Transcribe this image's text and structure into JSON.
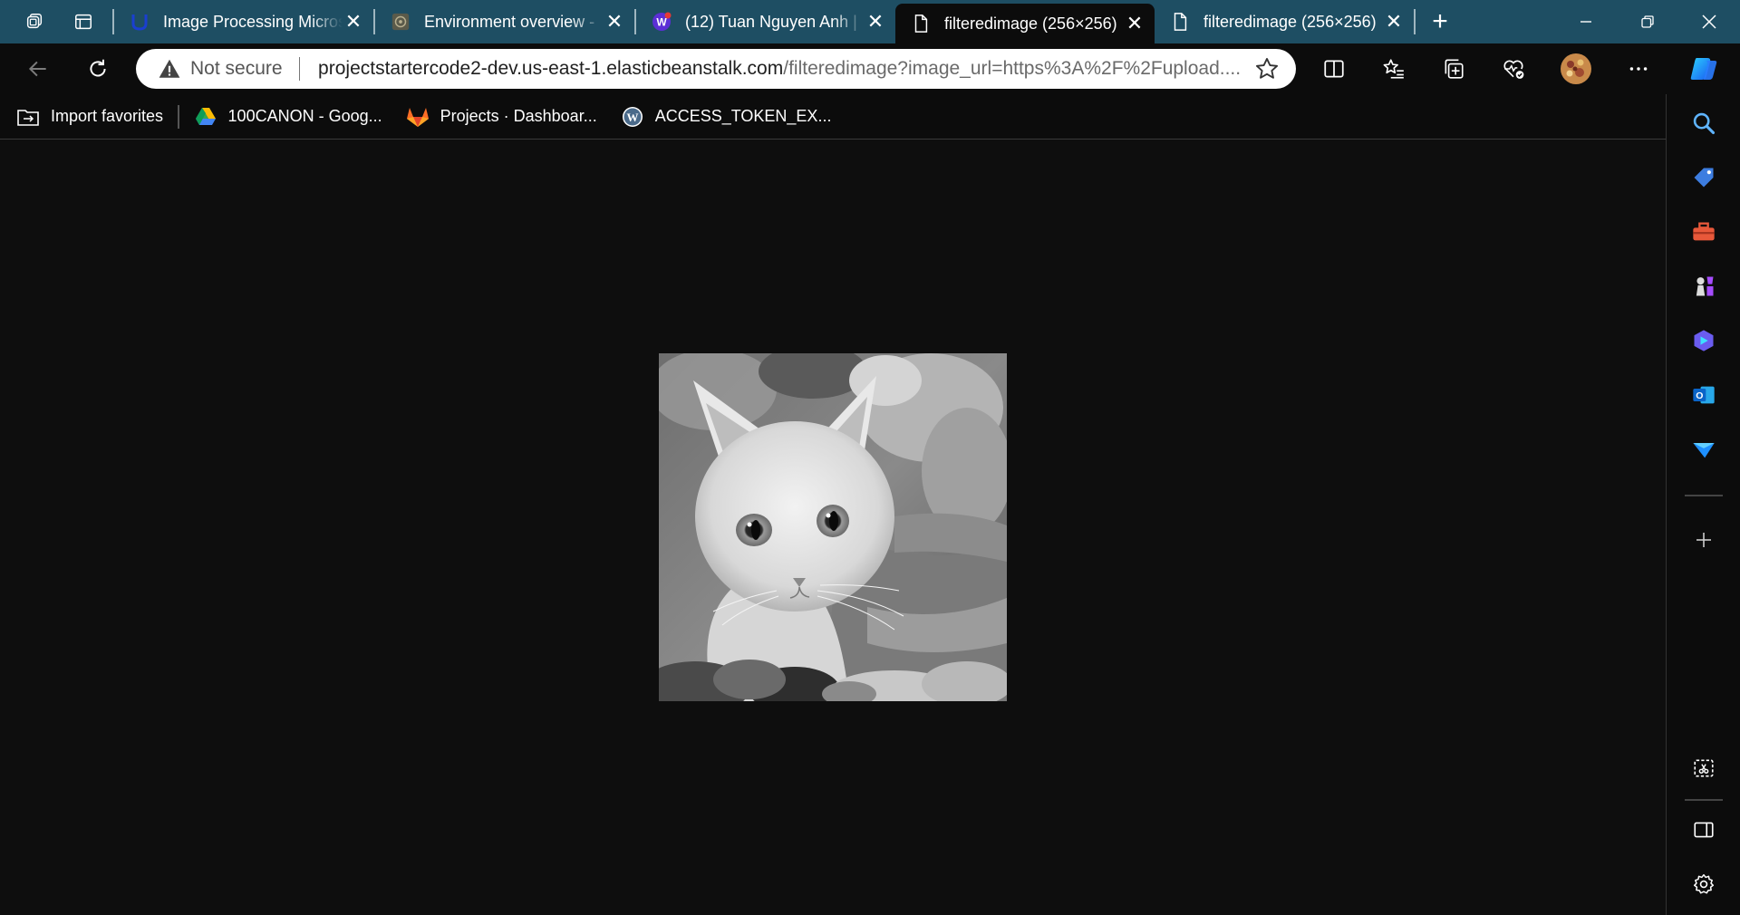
{
  "tabs": [
    {
      "title": "Image Processing Micros",
      "favicon": "udacity-icon",
      "active": false
    },
    {
      "title": "Environment overview - ",
      "favicon": "aws-beanstalk-icon",
      "active": false
    },
    {
      "title": "(12) Tuan Nguyen Anh | ",
      "favicon": "social-w-icon",
      "active": false
    },
    {
      "title": "filteredimage (256×256)",
      "favicon": "page-icon",
      "active": true
    },
    {
      "title": "filteredimage (256×256)",
      "favicon": "page-icon",
      "active": false
    }
  ],
  "address_bar": {
    "security_label": "Not secure",
    "url_host": "projectstartercode2-dev.us-east-1.elasticbeanstalk.com",
    "url_path": "/filteredimage?image_url=https%3A%2F%2Fupload...."
  },
  "favorites": [
    {
      "label": "Import favorites",
      "icon": "import-icon"
    },
    {
      "label": "100CANON - Goog...",
      "icon": "google-drive-icon"
    },
    {
      "label": "Projects · Dashboar...",
      "icon": "gitlab-icon"
    },
    {
      "label": "ACCESS_TOKEN_EX...",
      "icon": "wordpress-icon"
    }
  ],
  "colors": {
    "tab_strip": "#1e4e63",
    "toolbar": "#0c0c0c",
    "page_background": "#0e0e0e"
  },
  "content": {
    "image_description_icon": "grayscale-cat-image"
  }
}
